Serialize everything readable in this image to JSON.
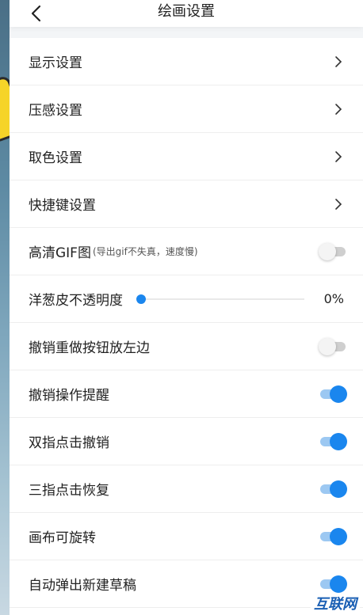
{
  "header": {
    "title": "绘画设置"
  },
  "settings": [
    {
      "label": "显示设置",
      "type": "link"
    },
    {
      "label": "压感设置",
      "type": "link"
    },
    {
      "label": "取色设置",
      "type": "link"
    },
    {
      "label": "快捷键设置",
      "type": "link"
    },
    {
      "label": "高清GIF图",
      "sublabel": "(导出gif不失真，速度慢)",
      "type": "toggle",
      "on": false
    },
    {
      "label": "洋葱皮不透明度",
      "type": "slider",
      "value": 0,
      "value_text": "0%"
    },
    {
      "label": "撤销重做按钮放左边",
      "type": "toggle",
      "on": false
    },
    {
      "label": "撤销操作提醒",
      "type": "toggle",
      "on": true
    },
    {
      "label": "双指点击撤销",
      "type": "toggle",
      "on": true
    },
    {
      "label": "三指点击恢复",
      "type": "toggle",
      "on": true
    },
    {
      "label": "画布可旋转",
      "type": "toggle",
      "on": true
    },
    {
      "label": "自动弹出新建草稿",
      "type": "toggle",
      "on": true
    }
  ],
  "watermark": "互联网",
  "colors": {
    "accent": "#1a86ee",
    "toggle_off": "#cfcfcf"
  }
}
